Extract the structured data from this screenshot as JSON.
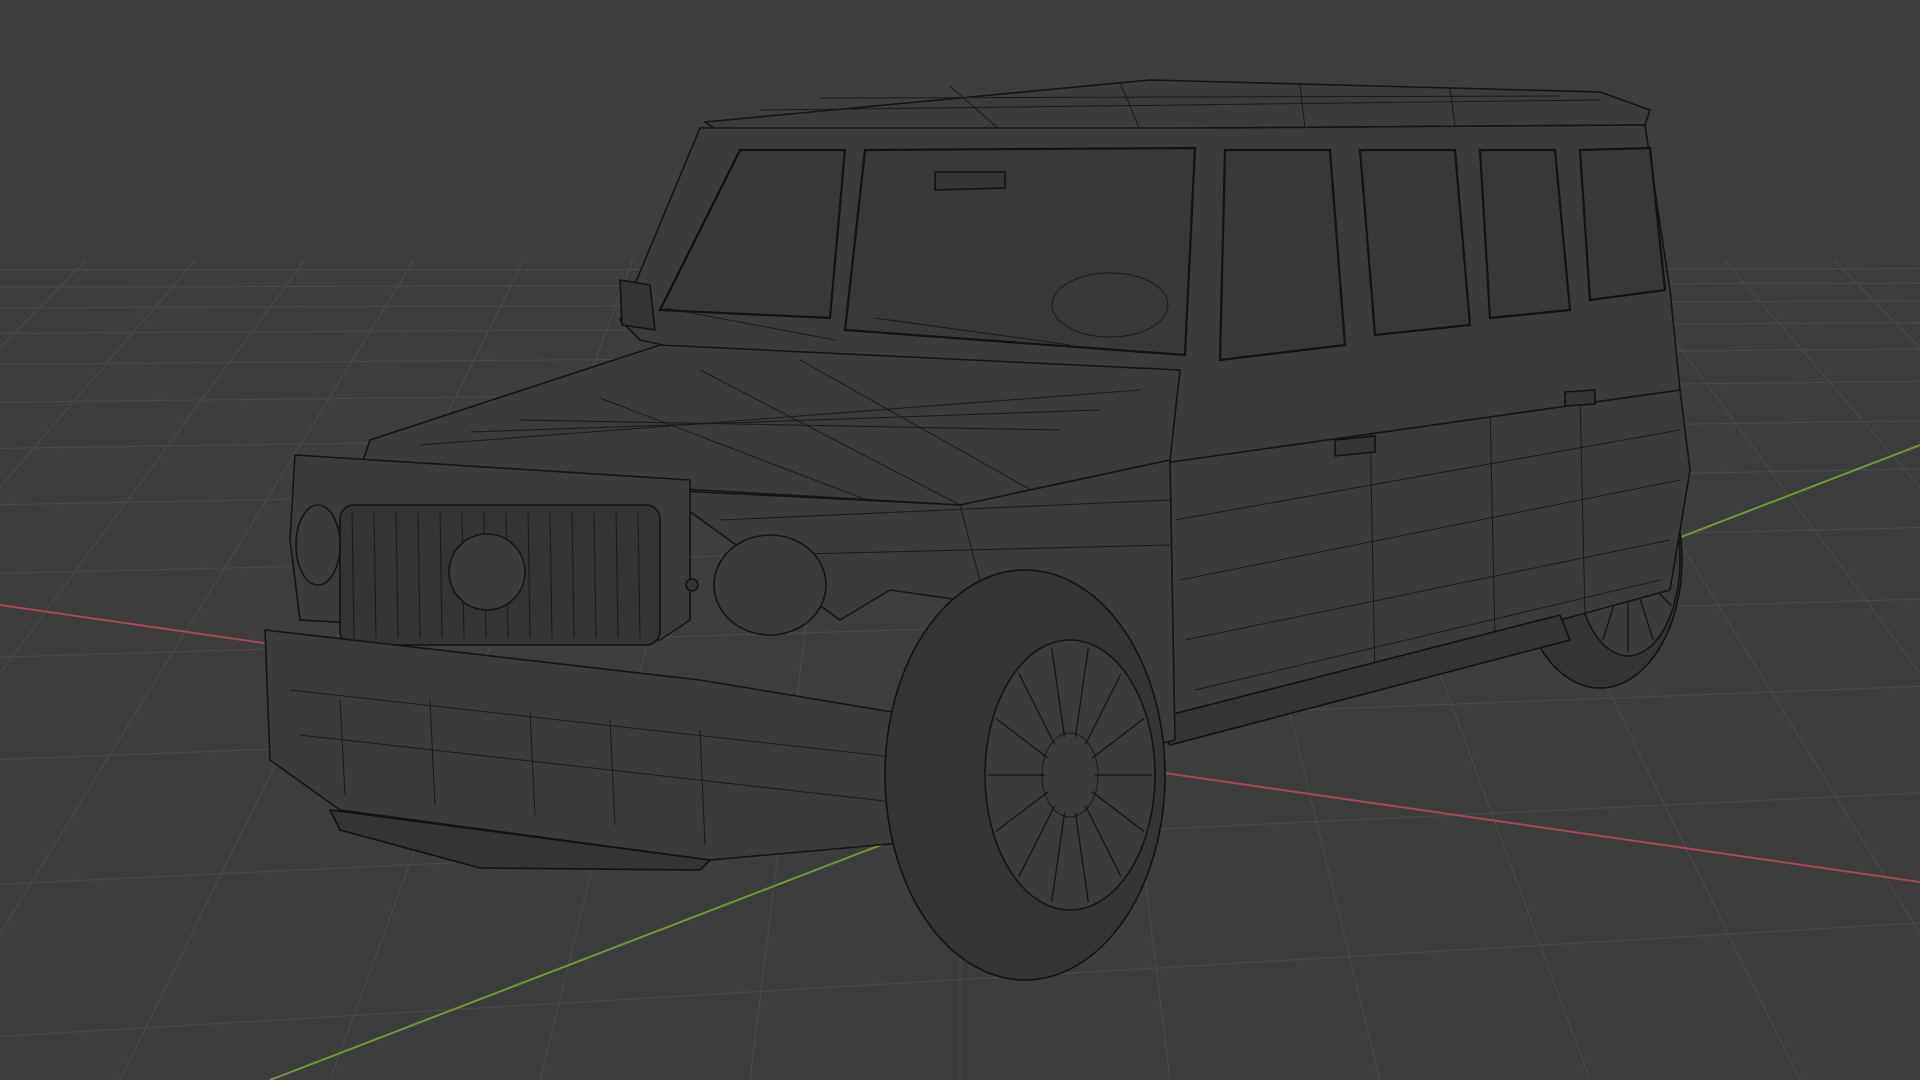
{
  "app": {
    "title": "",
    "view_mode": "wireframe"
  },
  "scene": {
    "object": "suv-wireframe-model",
    "background_color": "#3d3d3d",
    "grid_color": "#4a4a4a",
    "x_axis_color": "#a64a55",
    "y_axis_color": "#6f9a3c",
    "wire_color": "#141414"
  }
}
